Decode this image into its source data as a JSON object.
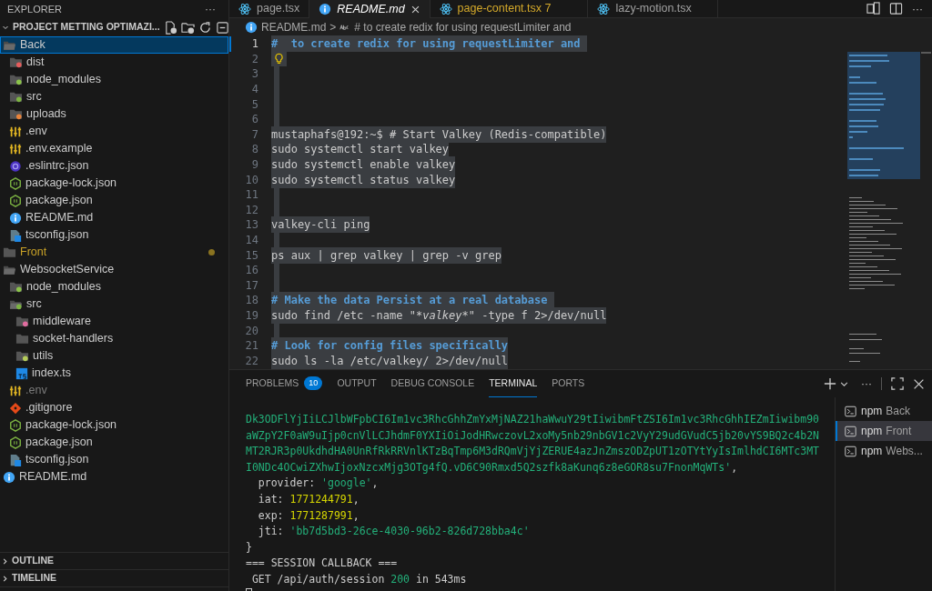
{
  "sidebar": {
    "title": "EXPLORER",
    "more": "···",
    "project": "PROJECT METTING OPTIMAZI...",
    "tree": [
      {
        "label": "Back",
        "kind": "folder",
        "expanded": true,
        "selected": true,
        "children": [
          {
            "label": "dist",
            "kind": "folder-dist",
            "expanded": false,
            "selected": false
          },
          {
            "label": "node_modules",
            "kind": "folder-node",
            "expanded": false,
            "selected": false
          },
          {
            "label": "src",
            "kind": "folder-src",
            "expanded": false,
            "selected": false
          },
          {
            "label": "uploads",
            "kind": "folder-uploads",
            "expanded": false,
            "selected": false
          },
          {
            "label": ".env",
            "kind": "env",
            "selected": false
          },
          {
            "label": ".env.example",
            "kind": "env",
            "selected": false
          },
          {
            "label": ".eslintrc.json",
            "kind": "eslint",
            "selected": false
          },
          {
            "label": "package-lock.json",
            "kind": "node",
            "selected": false
          },
          {
            "label": "package.json",
            "kind": "node",
            "selected": false
          },
          {
            "label": "README.md",
            "kind": "info",
            "selected": false
          },
          {
            "label": "tsconfig.json",
            "kind": "tsconfig",
            "selected": false
          }
        ]
      },
      {
        "label": "Front",
        "kind": "folder",
        "expanded": false,
        "selected": false,
        "modified": true
      },
      {
        "label": "WebsocketService",
        "kind": "folder",
        "expanded": true,
        "selected": false,
        "children": [
          {
            "label": "node_modules",
            "kind": "folder-node",
            "expanded": false,
            "selected": false
          },
          {
            "label": "src",
            "kind": "folder-src",
            "expanded": true,
            "selected": false,
            "children": [
              {
                "label": "middleware",
                "kind": "folder-middleware",
                "expanded": false,
                "selected": false
              },
              {
                "label": "socket-handlers",
                "kind": "folder",
                "expanded": false,
                "selected": false
              },
              {
                "label": "utils",
                "kind": "folder-utils",
                "expanded": false,
                "selected": false
              },
              {
                "label": "index.ts",
                "kind": "ts",
                "selected": false
              }
            ]
          },
          {
            "label": ".env",
            "kind": "env",
            "selected": false,
            "ignored": true
          },
          {
            "label": ".gitignore",
            "kind": "git",
            "selected": false
          },
          {
            "label": "package-lock.json",
            "kind": "node",
            "selected": false
          },
          {
            "label": "package.json",
            "kind": "node",
            "selected": false
          },
          {
            "label": "tsconfig.json",
            "kind": "tsconfig",
            "selected": false
          }
        ]
      },
      {
        "label": "README.md",
        "kind": "info",
        "selected": false
      }
    ],
    "sections": [
      "OUTLINE",
      "TIMELINE"
    ]
  },
  "tabs": [
    {
      "label": "page.tsx",
      "kind": "react",
      "selected": false
    },
    {
      "label": "README.md",
      "kind": "info",
      "selected": true
    },
    {
      "label": "page-content.tsx",
      "kind": "react",
      "selected": false,
      "problems": "7"
    },
    {
      "label": "lazy-motion.tsx",
      "kind": "react",
      "selected": false
    }
  ],
  "breadcrumb": {
    "file": "README.md",
    "separator": ">",
    "symbol": "# to create redix for using requestLimiter and"
  },
  "editor": {
    "lines": [
      {
        "number": "1",
        "kind": "heading",
        "text": "#  to create redix for using requestLimiter and "
      },
      {
        "number": "2",
        "kind": "lightbulb"
      },
      {
        "number": "3",
        "kind": "blank"
      },
      {
        "number": "4",
        "kind": "blank"
      },
      {
        "number": "5",
        "kind": "blank"
      },
      {
        "number": "6",
        "kind": "blank"
      },
      {
        "number": "7",
        "kind": "code",
        "text": "mustaphafs@192:~$ # Start Valkey (Redis-compatible)"
      },
      {
        "number": "8",
        "kind": "code",
        "text": "sudo systemctl start valkey"
      },
      {
        "number": "9",
        "kind": "code",
        "text": "sudo systemctl enable valkey"
      },
      {
        "number": "10",
        "kind": "code",
        "text": "sudo systemctl status valkey"
      },
      {
        "number": "11",
        "kind": "blank"
      },
      {
        "number": "12",
        "kind": "blank"
      },
      {
        "number": "13",
        "kind": "code",
        "text": "valkey-cli ping"
      },
      {
        "number": "14",
        "kind": "blank"
      },
      {
        "number": "15",
        "kind": "code",
        "text": "ps aux | grep valkey | grep -v grep"
      },
      {
        "number": "16",
        "kind": "blank"
      },
      {
        "number": "17",
        "kind": "blank"
      },
      {
        "number": "18",
        "kind": "heading",
        "text": "# Make the data Persist at a real database "
      },
      {
        "number": "19",
        "kind": "code",
        "segments": [
          {
            "text": "sudo find /etc -name \"",
            "italic": false
          },
          {
            "text": "*valkey*",
            "italic": true
          },
          {
            "text": "\" -type f 2>/dev/null",
            "italic": false
          }
        ]
      },
      {
        "number": "20",
        "kind": "blank"
      },
      {
        "number": "21",
        "kind": "heading",
        "text": "# Look for config files specifically"
      },
      {
        "number": "22",
        "kind": "code",
        "text": "sudo ls -la /etc/valkey/ 2>/dev/null"
      }
    ]
  },
  "panel": {
    "tabs": [
      {
        "label": "PROBLEMS",
        "selected": false,
        "count": "10"
      },
      {
        "label": "OUTPUT",
        "selected": false
      },
      {
        "label": "DEBUG CONSOLE",
        "selected": false
      },
      {
        "label": "TERMINAL",
        "selected": true
      },
      {
        "label": "PORTS",
        "selected": false
      }
    ],
    "terminal_lines": [
      [
        {
          "kind": "string",
          "text": "Dk3ODFlYjIiLCJlbWFpbCI6Im1vc3RhcGhhZmYxMjNAZ21haWwuY29tIiwibmFtZSI6Im1vc3RhcGhhIEZmIiwibm90"
        }
      ],
      [
        {
          "kind": "string",
          "text": "aWZpY2F0aW9uIjp0cnVlLCJhdmF0YXIiOiJodHRwczovL2xoMy5nb29nbGV1c2VyY29udGVudC5jb20vYS9BQ2c4b2N"
        }
      ],
      [
        {
          "kind": "string",
          "text": "MT2RJR3p0UkdhdHA0UnRfRkRRVnlKTzBqTmp6M3dRQmVjYjZERUE4azJnZmszODZpUT1zOTYtYyIsImlhdCI6MTc3MT"
        }
      ],
      [
        {
          "kind": "string",
          "text": "I0NDc4OCwiZXhwIjoxNzcxMjg3OTg4fQ.vD6C90Rmxd5Q2szfk8aKunq6z8eGOR8su7FnonMqWTs'"
        },
        {
          "kind": "plain",
          "text": ","
        }
      ],
      [
        {
          "kind": "plain",
          "text": "  provider: "
        },
        {
          "kind": "string",
          "text": "'google'"
        },
        {
          "kind": "plain",
          "text": ","
        }
      ],
      [
        {
          "kind": "plain",
          "text": "  iat: "
        },
        {
          "kind": "number",
          "text": "1771244791"
        },
        {
          "kind": "plain",
          "text": ","
        }
      ],
      [
        {
          "kind": "plain",
          "text": "  exp: "
        },
        {
          "kind": "number",
          "text": "1771287991"
        },
        {
          "kind": "plain",
          "text": ","
        }
      ],
      [
        {
          "kind": "plain",
          "text": "  jti: "
        },
        {
          "kind": "string",
          "text": "'bb7d5bd3-26ce-4030-96b2-826d728bba4c'"
        }
      ],
      [
        {
          "kind": "plain",
          "text": "}"
        }
      ],
      [
        {
          "kind": "plain",
          "text": "=== SESSION CALLBACK ==="
        }
      ],
      [
        {
          "kind": "plain",
          "text": " GET /api/auth/session "
        },
        {
          "kind": "string",
          "text": "200"
        },
        {
          "kind": "plain",
          "text": " in 543ms"
        }
      ]
    ],
    "terminals": [
      {
        "shell": "npm",
        "label": "Back",
        "selected": false
      },
      {
        "shell": "npm",
        "label": "Front",
        "selected": true
      },
      {
        "shell": "npm",
        "label": "Webs...",
        "selected": false
      }
    ],
    "more": "···"
  }
}
